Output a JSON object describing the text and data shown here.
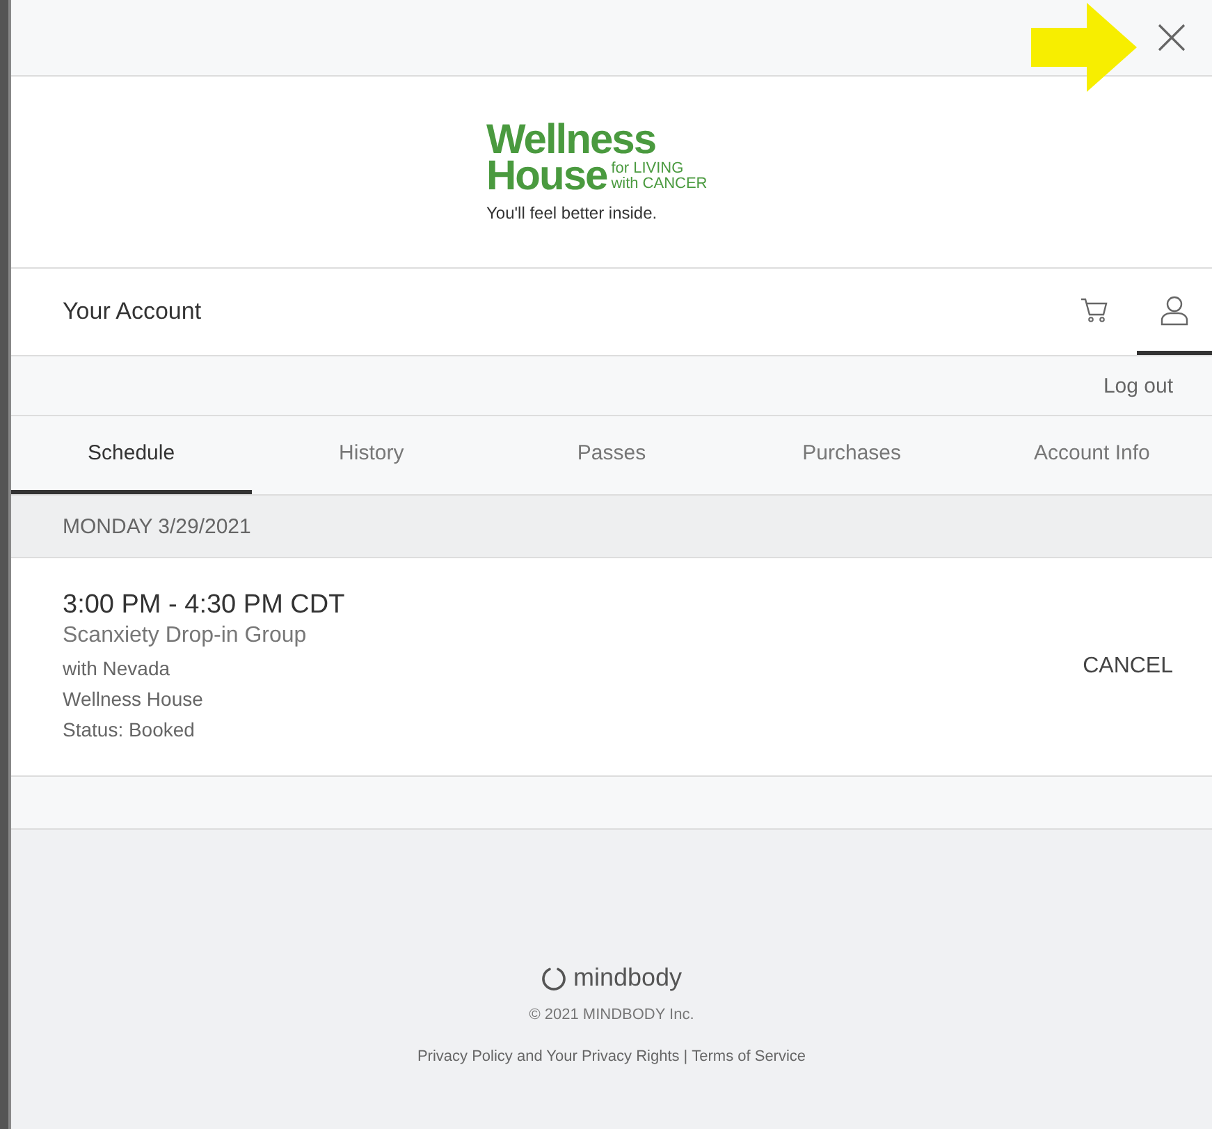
{
  "logo": {
    "line_1": "Wellness",
    "line_2": "House",
    "side_1": "for LIVING",
    "side_2": "with CANCER",
    "tagline": "You'll feel better inside."
  },
  "account_bar": {
    "title": "Your Account",
    "icons": [
      {
        "kind": "cart",
        "selected": false
      },
      {
        "kind": "user",
        "selected": true
      }
    ]
  },
  "logout": "Log out",
  "tabs": [
    {
      "label": "Schedule",
      "selected": true
    },
    {
      "label": "History",
      "selected": false
    },
    {
      "label": "Passes",
      "selected": false
    },
    {
      "label": "Purchases",
      "selected": false
    },
    {
      "label": "Account Info",
      "selected": false
    }
  ],
  "date_header": "MONDAY 3/29/2021",
  "bookings": [
    {
      "time": "3:00 PM - 4:30 PM CDT",
      "class_name": "Scanxiety Drop-in Group",
      "instructor": "with Nevada",
      "location": "Wellness House",
      "status": "Status: Booked",
      "action": "CANCEL"
    }
  ],
  "footer": {
    "brand": "mindbody",
    "copyright": "© 2021 MINDBODY Inc.",
    "links": [
      "Privacy Policy and Your Privacy Rights",
      "Terms of Service"
    ],
    "separator": "|"
  }
}
